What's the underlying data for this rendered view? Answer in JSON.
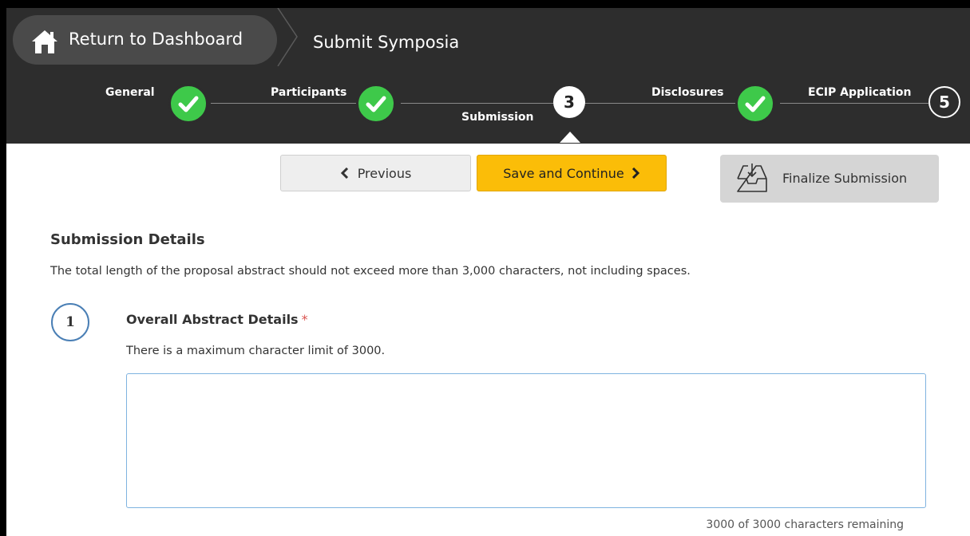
{
  "header": {
    "dashboard_label": "Return to Dashboard",
    "page_title": "Submit Symposia"
  },
  "steps": [
    {
      "label": "General",
      "state": "complete"
    },
    {
      "label": "Participants",
      "state": "complete"
    },
    {
      "label": "Submission",
      "state": "current",
      "number": "3"
    },
    {
      "label": "Disclosures",
      "state": "complete"
    },
    {
      "label": "ECIP Application",
      "state": "pending",
      "number": "5"
    }
  ],
  "actions": {
    "previous_label": "Previous",
    "save_label": "Save and Continue",
    "finalize_label": "Finalize Submission"
  },
  "section": {
    "title": "Submission Details",
    "description": "The total length of the proposal abstract should not exceed more than 3,000 characters, not including spaces."
  },
  "question": {
    "number": "1",
    "title": "Overall Abstract Details",
    "required_marker": "*",
    "hint": "There is a maximum character limit of 3000.",
    "value": "",
    "counter": "3000 of 3000 characters remaining"
  },
  "colors": {
    "header_bg": "#2d2d2d",
    "complete_green": "#3ec94a",
    "save_yellow": "#fbbd08",
    "required_red": "#d9534f"
  }
}
